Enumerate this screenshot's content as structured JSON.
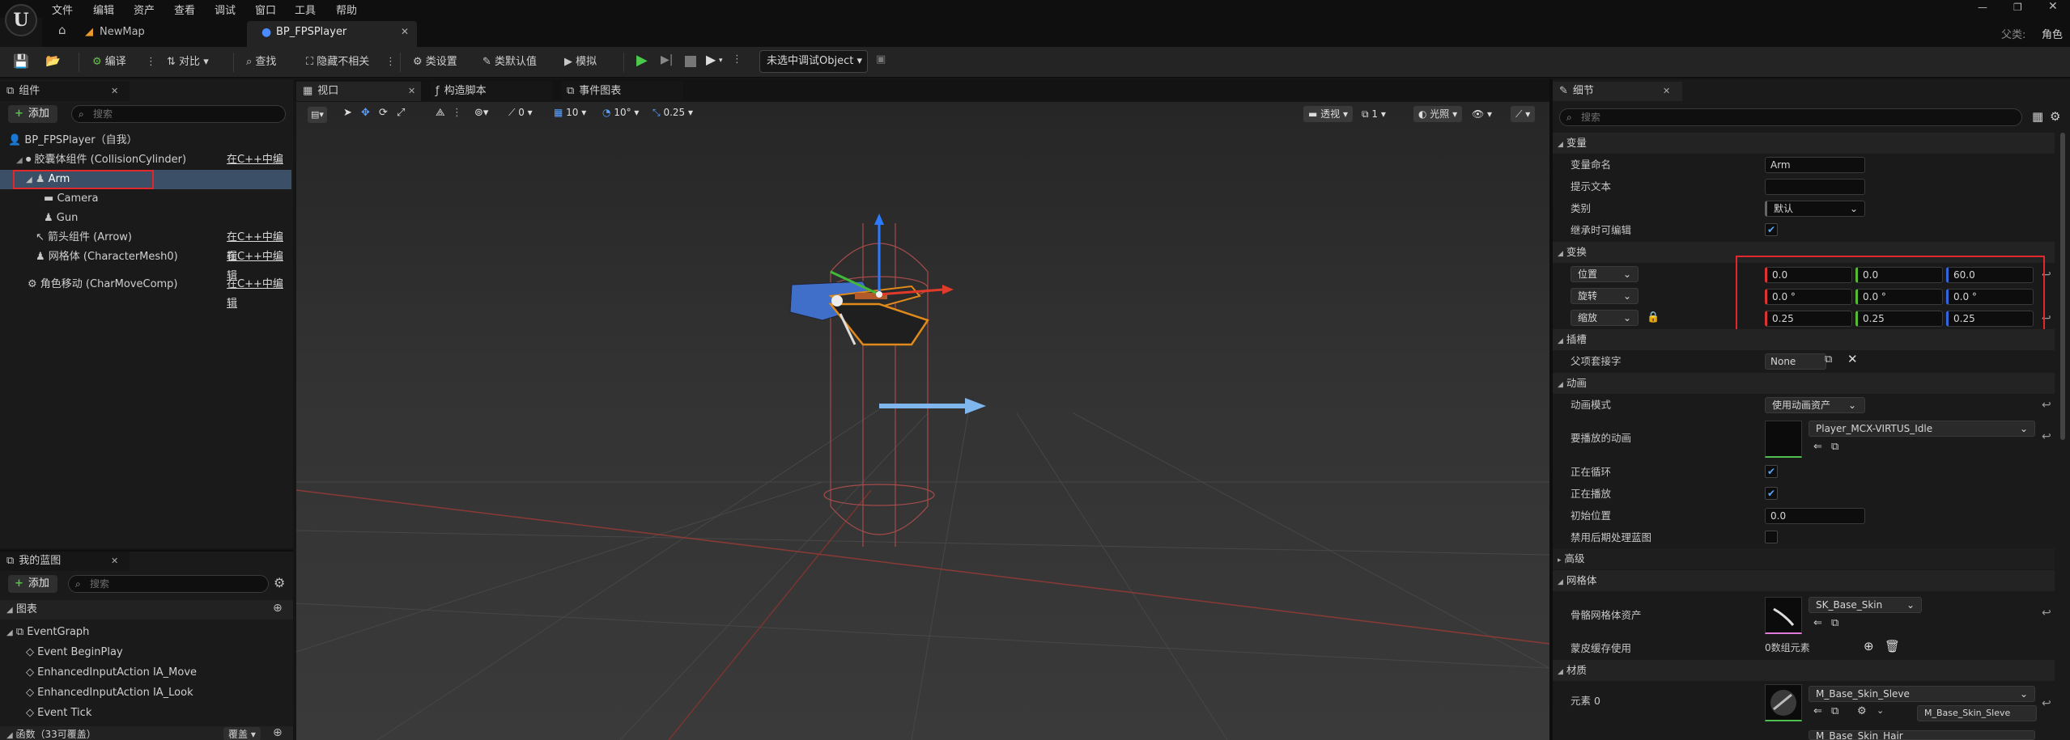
{
  "menu": [
    "文件",
    "编辑",
    "资产",
    "查看",
    "调试",
    "窗口",
    "工具",
    "帮助"
  ],
  "tabs": [
    {
      "label": "NewMap"
    },
    {
      "label": "BP_FPSPlayer"
    }
  ],
  "parent_label": "父类:",
  "parent_value": "角色",
  "toolbar": {
    "compile": "编译",
    "diff": "对比",
    "find": "查找",
    "hide_unrelated": "隐藏不相关",
    "class_settings": "类设置",
    "class_defaults": "类默认值",
    "simulate": "模拟",
    "debug_object": "未选中调试Object"
  },
  "components": {
    "title": "组件",
    "add": "添加",
    "search_placeholder": "搜索",
    "items": [
      {
        "label": "BP_FPSPlayer（自我）",
        "edit": ""
      },
      {
        "label": "胶囊体组件 (CollisionCylinder)",
        "edit": "在C++中编辑"
      },
      {
        "label": "Arm",
        "edit": ""
      },
      {
        "label": "Camera",
        "edit": ""
      },
      {
        "label": "Gun",
        "edit": ""
      },
      {
        "label": "箭头组件 (Arrow)",
        "edit": "在C++中编辑"
      },
      {
        "label": "网格体 (CharacterMesh0)",
        "edit": "在C++中编辑"
      },
      {
        "label": "角色移动 (CharMoveComp)",
        "edit": "在C++中编辑"
      }
    ]
  },
  "my_blueprint": {
    "title": "我的蓝图",
    "add": "添加",
    "search_placeholder": "搜索",
    "graphs_label": "图表",
    "event_graph": "EventGraph",
    "events": [
      "Event BeginPlay",
      "EnhancedInputAction IA_Move",
      "EnhancedInputAction IA_Look",
      "Event Tick"
    ],
    "functions_label": "函数（33可覆盖）",
    "override_label": "覆盖"
  },
  "center_tabs": {
    "viewport": "视口",
    "construction": "构造脚本",
    "event_graph": "事件图表"
  },
  "viewport_toolbar": {
    "rot_value": "0",
    "grid_snap": "10",
    "rot_snap": "10°",
    "scale_snap": "0.25",
    "perspective": "透视",
    "speed": "1",
    "lit": "光照"
  },
  "details": {
    "title": "细节",
    "search_placeholder": "搜索",
    "sections": {
      "variable": "变量",
      "transform": "变换",
      "sockets": "插槽",
      "animation": "动画",
      "advanced": "高级",
      "mesh": "网格体",
      "materials": "材质"
    },
    "variable_name_label": "变量命名",
    "variable_name": "Arm",
    "tooltip_label": "提示文本",
    "tooltip": "",
    "category_label": "类别",
    "category": "默认",
    "editable_label": "继承时可编辑",
    "location_label": "位置",
    "location": [
      "0.0",
      "0.0",
      "60.0"
    ],
    "rotation_label": "旋转",
    "rotation": [
      "0.0 °",
      "0.0 °",
      "0.0 °"
    ],
    "scale_label": "缩放",
    "scale": [
      "0.25",
      "0.25",
      "0.25"
    ],
    "parent_socket_label": "父项套接字",
    "parent_socket": "None",
    "anim_mode_label": "动画模式",
    "anim_mode": "使用动画资产",
    "anim_to_play_label": "要播放的动画",
    "anim_to_play": "Player_MCX-VIRTUS_Idle",
    "looping_label": "正在循环",
    "playing_label": "正在播放",
    "initial_pos_label": "初始位置",
    "initial_pos": "0.0",
    "disable_post_label": "禁用后期处理蓝图",
    "skeletal_mesh_label": "骨骼网格体资产",
    "skeletal_mesh": "SK_Base_Skin",
    "skin_cache_label": "蒙皮缓存使用",
    "skin_cache_value": "0数组元素",
    "element0_label": "元素 0",
    "element0": "M_Base_Skin_Sleve",
    "element0_sub": "M_Base_Skin_Sleve",
    "element1": "M_Base_Skin_Hair"
  }
}
